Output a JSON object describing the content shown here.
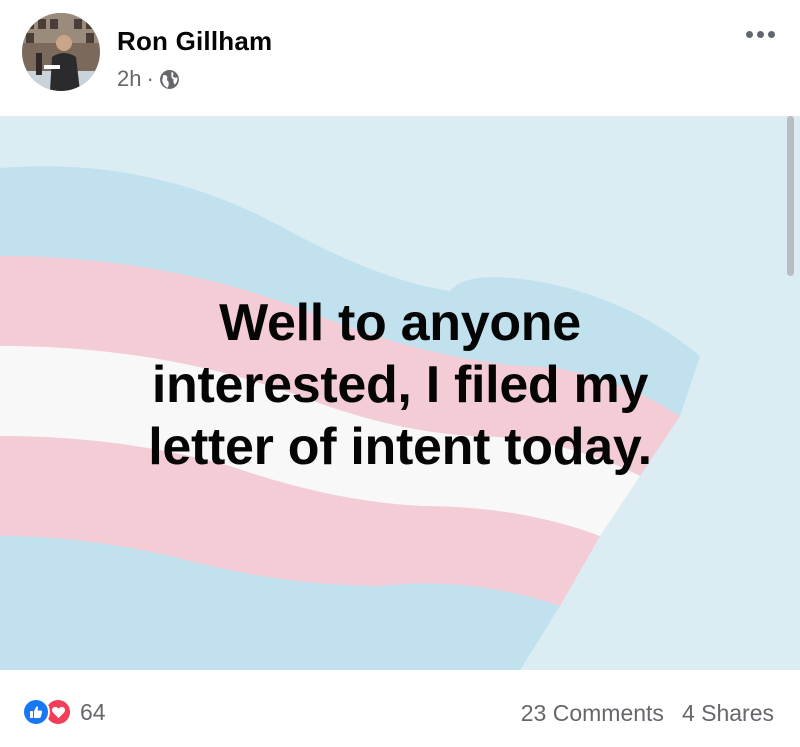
{
  "author": {
    "name": "Ron Gillham",
    "time": "2h",
    "separator": "·",
    "privacy_icon": "globe-icon"
  },
  "more_icon": "more-horizontal-icon",
  "post": {
    "text": "Well to anyone\ninterested, I filed my\nletter of intent today.",
    "background_colors": {
      "sky": "#d6eaf2",
      "blue_stripe": "#b8dcea",
      "pink_stripe": "#f2c6d0",
      "white_stripe": "#f7f7f7"
    }
  },
  "engagement": {
    "reaction_icons": [
      "like-icon",
      "love-icon"
    ],
    "reaction_count": "64",
    "comments": "23 Comments",
    "shares": "4 Shares"
  },
  "colors": {
    "like": "#1877f2",
    "love": "#f33e58",
    "secondary_text": "#65676b",
    "primary_text": "#050505"
  }
}
